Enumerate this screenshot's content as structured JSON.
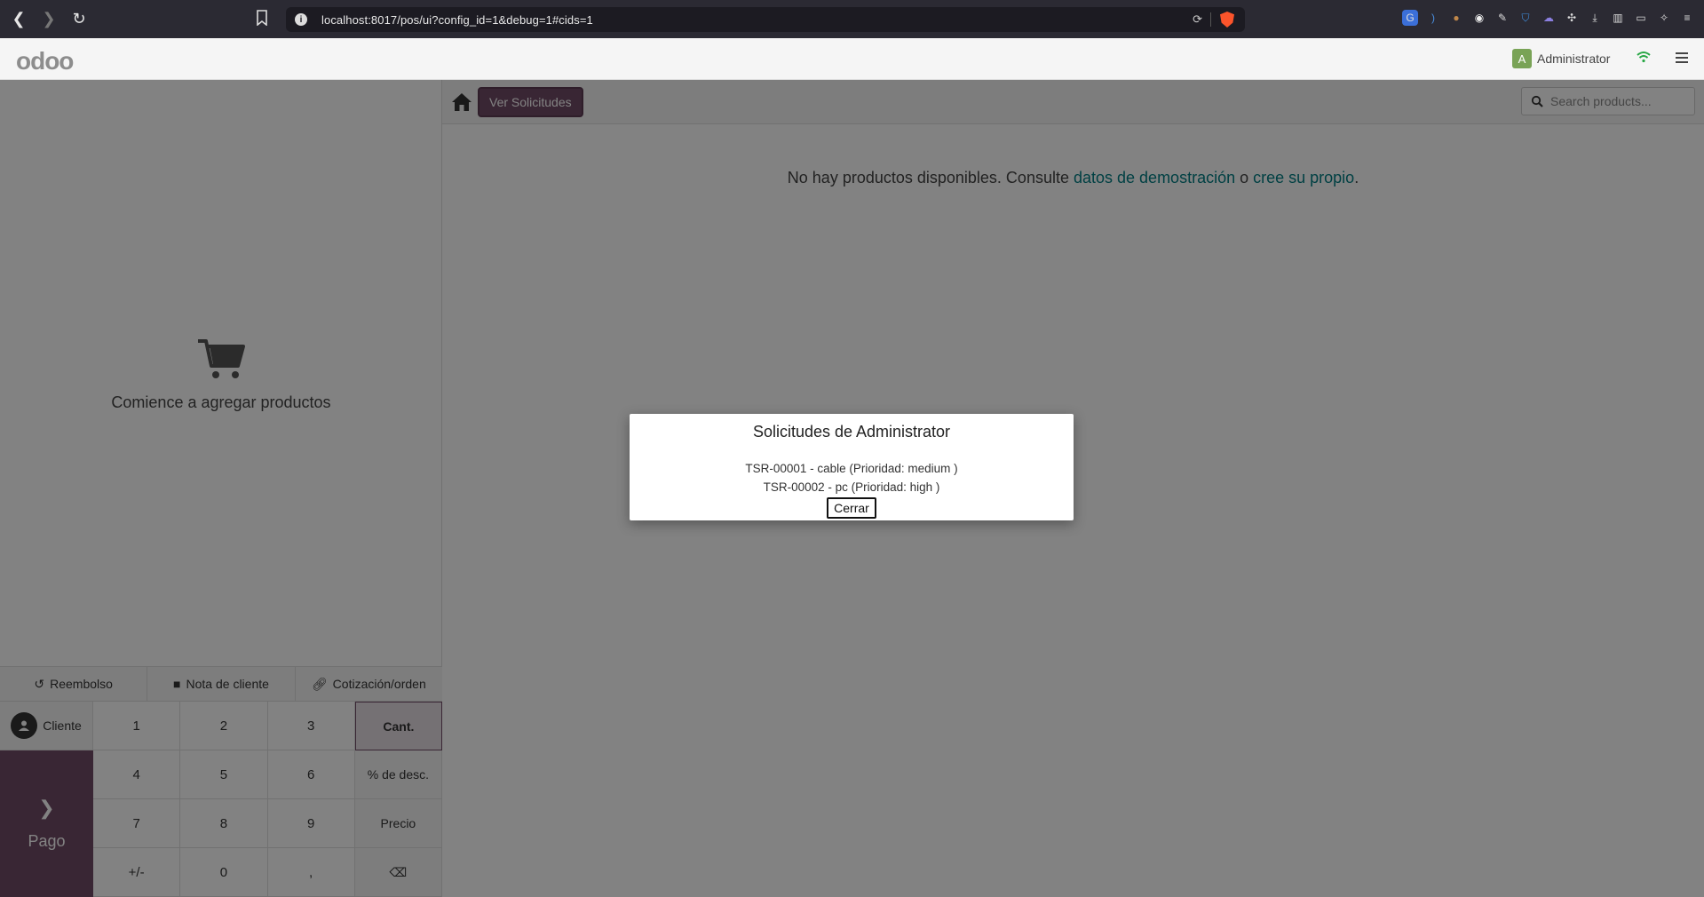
{
  "browser": {
    "url": "localhost:8017/pos/ui?config_id=1&debug=1#cids=1"
  },
  "header": {
    "logo": "odoo",
    "avatar_initial": "A",
    "user_name": "Administrator"
  },
  "order": {
    "empty_text": "Comience a agregar productos"
  },
  "controls": {
    "refund": "Reembolso",
    "customer_note": "Nota de cliente",
    "quotation": "Cotización/orden"
  },
  "pad": {
    "customer": "Cliente",
    "payment": "Pago",
    "keys": [
      "1",
      "2",
      "3",
      "Cant.",
      "4",
      "5",
      "6",
      "% de desc.",
      "7",
      "8",
      "9",
      "Precio",
      "+/-",
      "0",
      ",",
      "⌫"
    ]
  },
  "toolbar": {
    "requests_button": "Ver Solicitudes",
    "search_placeholder": "Search products..."
  },
  "products": {
    "empty_part1": "No hay productos disponibles. Consulte ",
    "demo_link": "datos de demostración",
    "empty_part2": " o ",
    "create_link": "cree su propio",
    "empty_part3": "."
  },
  "dialog": {
    "title": "Solicitudes de Administrator",
    "lines": [
      "TSR-00001 - cable (Prioridad: medium )",
      "TSR-00002 - pc (Prioridad: high )"
    ],
    "close_button": "Cerrar"
  },
  "colors": {
    "primary": "#714b67",
    "link": "#017e84",
    "overlay": "rgba(0,0,0,0.49)"
  }
}
